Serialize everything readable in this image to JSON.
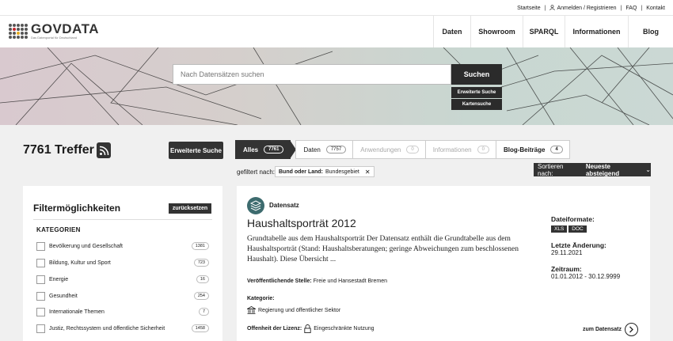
{
  "topbar": {
    "links": [
      "Startseite",
      "Anmelden / Registrieren",
      "FAQ",
      "Kontakt"
    ]
  },
  "logo": {
    "name": "GOVDATA",
    "tagline": "Das Datenportal für Deutschland"
  },
  "nav": [
    "Daten",
    "Showroom",
    "SPARQL",
    "Informationen",
    "Blog"
  ],
  "search": {
    "placeholder": "Nach Datensätzen suchen",
    "button": "Suchen",
    "advanced": "Erweiterte Suche",
    "map": "Kartensuche"
  },
  "results": {
    "count": "7761 Treffer",
    "advanced_button": "Erweiterte Suche",
    "tabs": [
      {
        "label": "Alles",
        "count": "7761"
      },
      {
        "label": "Daten",
        "count": "7757"
      },
      {
        "label": "Anwendungen",
        "count": "0"
      },
      {
        "label": "Informationen",
        "count": "0"
      },
      {
        "label": "Blog-Beiträge",
        "count": "4"
      }
    ],
    "filtered_label": "gefiltert nach:",
    "filter_key": "Bund oder Land:",
    "filter_value": "Bundesgebiet",
    "sort_label": "Sortieren nach:",
    "sort_value": "Neueste absteigend"
  },
  "sidebar": {
    "title": "Filtermöglichkeiten",
    "reset": "zurücksetzen",
    "category_heading": "KATEGORIEN",
    "items": [
      {
        "label": "Bevölkerung und Gesellschaft",
        "count": "1381"
      },
      {
        "label": "Bildung, Kultur und Sport",
        "count": "723"
      },
      {
        "label": "Energie",
        "count": "16"
      },
      {
        "label": "Gesundheit",
        "count": "254"
      },
      {
        "label": "Internationale Themen",
        "count": "7"
      },
      {
        "label": "Justiz, Rechtssystem und öffentliche Sicherheit",
        "count": "1458"
      }
    ]
  },
  "dataset": {
    "type": "Datensatz",
    "title": "Haushaltsporträt 2012",
    "description": "Grundtabelle aus dem Haushaltsporträt Der Datensatz enthält die Grundtabelle aus dem Haushaltsporträt (Stand: Haushaltsberatungen; geringe Abweichungen zum beschlossenen Haushalt). Diese Übersicht ...",
    "publisher_label": "Veröffentlichende Stelle:",
    "publisher": "Freie und Hansestadt Bremen",
    "category_label": "Kategorie:",
    "category": "Regierung und öffentlicher Sektor",
    "license_label": "Offenheit der Lizenz:",
    "license": "Eingeschränkte Nutzung",
    "formats_label": "Dateiformate:",
    "formats": [
      "XLS",
      "DOC"
    ],
    "modified_label": "Letzte Änderung:",
    "modified": "29.11.2021",
    "period_label": "Zeitraum:",
    "period": "01.01.2012 - 30.12.9999",
    "link": "zum Datensatz"
  }
}
